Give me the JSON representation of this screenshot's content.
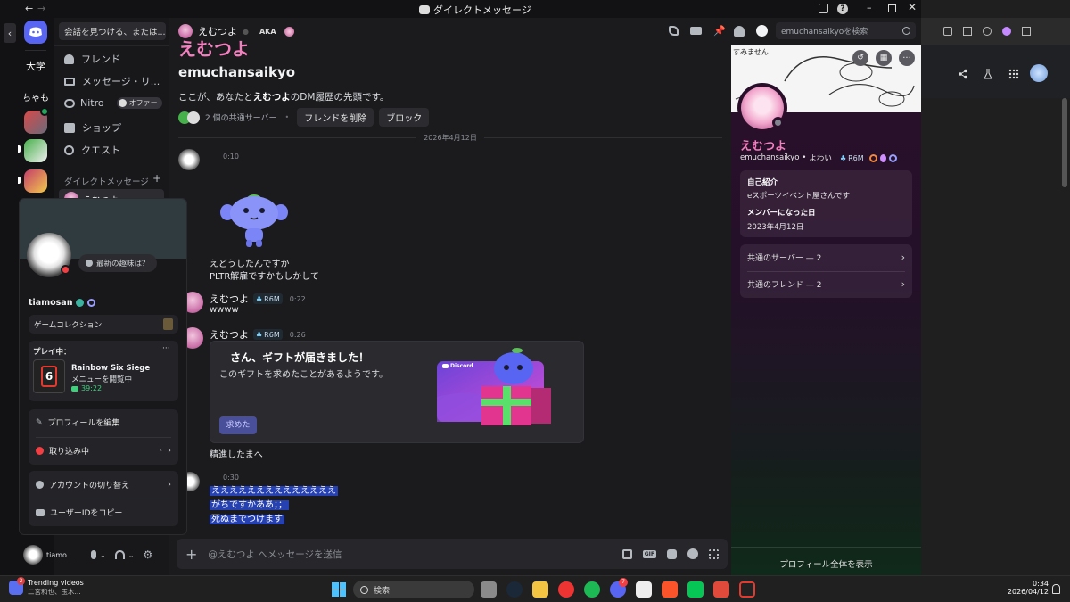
{
  "window": {
    "title": "ダイレクトメッセージ"
  },
  "sidebar": {
    "search_placeholder": "会話を見つける、または...",
    "server_labels": [
      "大学",
      "ちゃも"
    ],
    "nav": [
      {
        "label": "フレンド",
        "icon": "friends-icon"
      },
      {
        "label": "メッセージ・リ...",
        "icon": "mail-icon"
      },
      {
        "label": "Nitro",
        "icon": "nitro-icon"
      },
      {
        "label": "ショップ",
        "icon": "shop-icon"
      },
      {
        "label": "クエスト",
        "icon": "quest-icon"
      }
    ],
    "nitro_badge": "オファー",
    "dm_header": "ダイレクトメッセージ",
    "dm_add": "+",
    "dm_first_name": "えむつよ"
  },
  "user_popout": {
    "status_bubble": "最新の趣味は？",
    "username": "tiamosan",
    "game_collection": "ゲームコレクション",
    "playing_label": "プレイ中：",
    "more": "···",
    "game_title": "Rainbow Six Siege",
    "game_status": "メニューを閲覧中",
    "game_time": "39:22",
    "menu1": [
      "プロフィールを編集",
      "取り込み中"
    ],
    "menu2": [
      "アカウントの切り替え",
      "ユーザーIDをコピー"
    ]
  },
  "userbar": {
    "name": "tiamo..."
  },
  "chat_header": {
    "name": "えむつよ",
    "tag": "AKA",
    "search_placeholder": "emuchansaikyoを検索"
  },
  "intro": {
    "display_name": "えむつよ",
    "username": "emuchansaikyo",
    "desc_prefix": "ここが、あなたと",
    "desc_bold": "えむつよ",
    "desc_suffix": "のDM履歴の先頭です。",
    "mutual_servers": "2 個の共通サーバー",
    "sep": "•",
    "remove_friend": "フレンドを削除",
    "block": "ブロック"
  },
  "date_divider": "2026年4月12日",
  "messages": [
    {
      "time": "0:10"
    },
    {
      "lines": [
        "えどうしたんですか",
        "PLTR解雇ですかもしかして"
      ]
    },
    {
      "name": "えむつよ",
      "role": "R6M",
      "time": "0:22",
      "text": "wwww"
    },
    {
      "name": "えむつよ",
      "role": "R6M",
      "time": "0:26"
    }
  ],
  "gift": {
    "title": "さん、ギフトが届きました！",
    "desc": "このギフトを求めたことがあるようです。",
    "button": "求めた",
    "brand": "Discord"
  },
  "after_gift": "精進したまへ",
  "last_group": {
    "time": "0:30",
    "lines": [
      "ええええええええええええええ",
      "がちですかああ；；",
      "死ぬまでつけます"
    ]
  },
  "composer": {
    "placeholder": "@えむつよ へメッセージを送信",
    "gif": "GIF"
  },
  "profile": {
    "display_name": "えむつよ",
    "username": "emuchansaikyo",
    "pronoun": "よわい",
    "sep": "•",
    "role": "R6M",
    "about_label": "自己紹介",
    "about_text": "eスポーツイベント屋さんです",
    "member_label": "メンバーになった日",
    "member_date": "2023年4月12日",
    "mutual_servers": "共通のサーバー — 2",
    "mutual_friends": "共通のフレンド — 2",
    "view_full": "プロフィール全体を表示",
    "banner_text": "すみません"
  },
  "taskbar": {
    "trending_title": "Trending videos",
    "trending_sub": "二宮和也、玉木...",
    "trending_badge": "2",
    "search": "検索",
    "discord_badge": "7",
    "clock_time": "0:34",
    "clock_date": "2026/04/12"
  },
  "colors": {
    "accent": "#5865f2",
    "highlight": "#2541b2",
    "brand_pink": "#f47fbf"
  }
}
